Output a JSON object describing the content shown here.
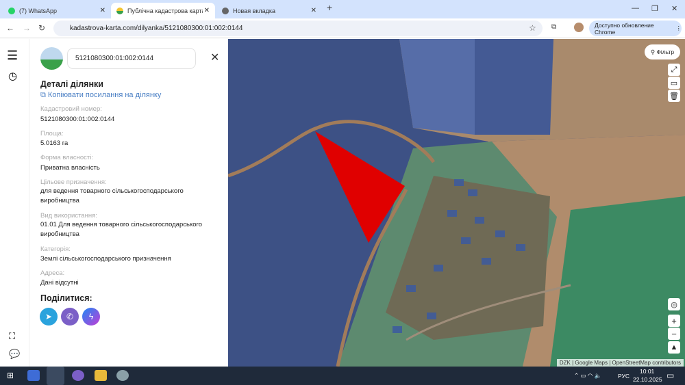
{
  "browser": {
    "tabs": [
      {
        "label": "(7) WhatsApp"
      },
      {
        "label": "Публічна кадастрова карта Ук"
      },
      {
        "label": "Новая вкладка"
      }
    ],
    "url": "kadastrova-karta.com/dilyanka/5121080300:01:002:0144",
    "update_label": "Доступно обновление Chrome"
  },
  "panel": {
    "search_value": "5121080300:01:002:0144",
    "title": "Деталі ділянки",
    "copy_link": "Копіювати посилання на ділянку",
    "fields": [
      {
        "label": "Кадастровий номер:",
        "value": "5121080300:01:002:0144"
      },
      {
        "label": "Площа:",
        "value": "5.0163 га"
      },
      {
        "label": "Форма власності:",
        "value": "Приватна власність"
      },
      {
        "label": "Цільове призначення:",
        "value": "для ведення товарного сільськогосподарського виробництва"
      },
      {
        "label": "Вид використання:",
        "value": "01.01 Для ведення товарного сільськогосподарського виробництва"
      },
      {
        "label": "Категорія:",
        "value": "Землі сільськогосподарського призначення"
      },
      {
        "label": "Адреса:",
        "value": "Дані відсутні"
      }
    ],
    "share_title": "Поділитися:"
  },
  "map": {
    "filter_label": "Фільтр",
    "attribution": "DZK | Google Maps | OpenStreetMap contributors",
    "zoom_in": "+",
    "zoom_out": "−",
    "parcel_color": "#e00000"
  },
  "taskbar": {
    "lang": "РУС",
    "time": "10:01",
    "date": "22.10.2025"
  }
}
